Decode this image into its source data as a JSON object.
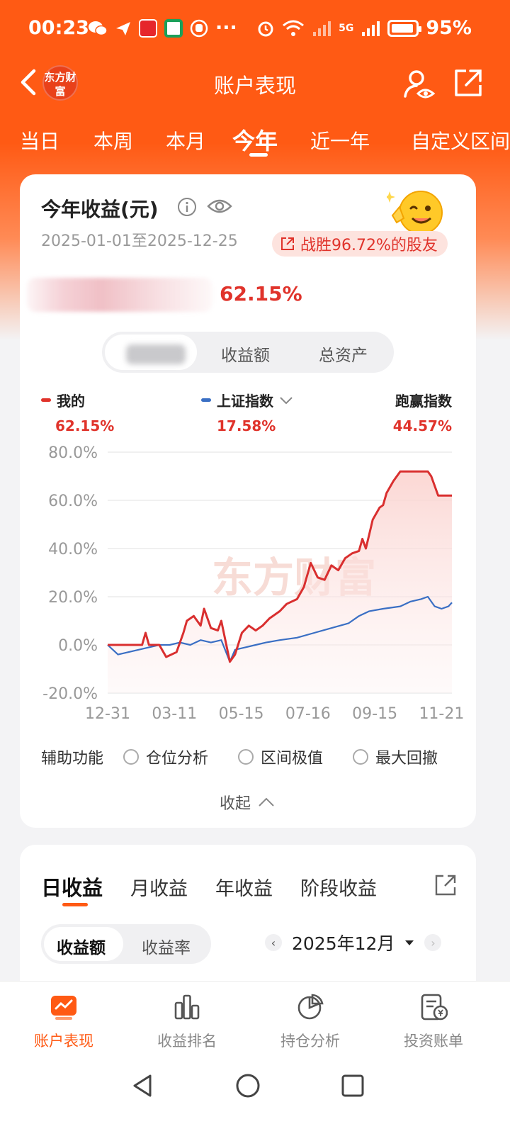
{
  "status_bar": {
    "time": "00:23",
    "more": "···",
    "signal_label": "5G",
    "battery": "95%"
  },
  "nav": {
    "logo_text": "东方财富",
    "title": "账户表现"
  },
  "period_tabs": [
    {
      "label": "当日"
    },
    {
      "label": "本周"
    },
    {
      "label": "本月"
    },
    {
      "label": "今年",
      "active": true
    },
    {
      "label": "近一年"
    },
    {
      "label": "自定义区间"
    }
  ],
  "summary": {
    "title": "今年收益(元)",
    "date_range": "2025-01-01至2025-12-25",
    "beat_text": "战胜96.72%的股友",
    "return_pct": "62.15%"
  },
  "segment": {
    "items": [
      "收益额",
      "总资产"
    ]
  },
  "legend": [
    {
      "name": "我的",
      "value": "62.15%",
      "color": "#e0332b"
    },
    {
      "name": "上证指数",
      "value": "17.58%",
      "color": "#3a6fc4",
      "dropdown": true
    },
    {
      "name": "跑赢指数",
      "value": "44.57%"
    }
  ],
  "chart_data": {
    "type": "line",
    "watermark": "东方财富",
    "y_ticks": [
      "80.0%",
      "60.0%",
      "40.0%",
      "20.0%",
      "0.0%",
      "-20.0%"
    ],
    "ylim": [
      -20,
      80
    ],
    "x_ticks": [
      "12-31",
      "03-11",
      "05-15",
      "07-16",
      "09-15",
      "11-21"
    ],
    "xlim": [
      0,
      1
    ],
    "series": [
      {
        "name": "我的",
        "color": "#d92f2f",
        "points": [
          [
            0,
            0
          ],
          [
            0.1,
            0
          ],
          [
            0.11,
            5
          ],
          [
            0.12,
            0
          ],
          [
            0.15,
            0
          ],
          [
            0.17,
            -5
          ],
          [
            0.2,
            -3
          ],
          [
            0.22,
            5
          ],
          [
            0.23,
            10
          ],
          [
            0.25,
            12
          ],
          [
            0.27,
            8
          ],
          [
            0.28,
            15
          ],
          [
            0.3,
            7
          ],
          [
            0.32,
            6
          ],
          [
            0.33,
            10
          ],
          [
            0.355,
            -7
          ],
          [
            0.37,
            -4
          ],
          [
            0.39,
            5
          ],
          [
            0.41,
            8
          ],
          [
            0.43,
            6
          ],
          [
            0.45,
            8
          ],
          [
            0.47,
            11
          ],
          [
            0.5,
            14
          ],
          [
            0.52,
            17
          ],
          [
            0.55,
            19
          ],
          [
            0.57,
            24
          ],
          [
            0.59,
            34
          ],
          [
            0.61,
            28
          ],
          [
            0.63,
            27
          ],
          [
            0.65,
            33
          ],
          [
            0.67,
            31
          ],
          [
            0.69,
            36
          ],
          [
            0.71,
            38
          ],
          [
            0.73,
            39
          ],
          [
            0.74,
            44
          ],
          [
            0.75,
            40
          ],
          [
            0.76,
            46
          ],
          [
            0.77,
            52
          ],
          [
            0.79,
            57
          ],
          [
            0.8,
            58
          ],
          [
            0.81,
            63
          ],
          [
            0.83,
            68
          ],
          [
            0.85,
            72
          ],
          [
            0.87,
            72
          ],
          [
            0.92,
            72
          ],
          [
            0.93,
            72
          ],
          [
            0.94,
            70
          ],
          [
            0.96,
            62
          ],
          [
            0.98,
            62
          ],
          [
            1,
            62
          ]
        ]
      },
      {
        "name": "上证指数",
        "color": "#3a6fc4",
        "points": [
          [
            0,
            0
          ],
          [
            0.03,
            -4
          ],
          [
            0.06,
            -3
          ],
          [
            0.09,
            -2
          ],
          [
            0.12,
            -1
          ],
          [
            0.15,
            0
          ],
          [
            0.18,
            0
          ],
          [
            0.21,
            1
          ],
          [
            0.24,
            0
          ],
          [
            0.27,
            2
          ],
          [
            0.3,
            1
          ],
          [
            0.33,
            2
          ],
          [
            0.355,
            -7
          ],
          [
            0.37,
            -2
          ],
          [
            0.4,
            -1
          ],
          [
            0.43,
            0
          ],
          [
            0.46,
            1
          ],
          [
            0.5,
            2
          ],
          [
            0.55,
            3
          ],
          [
            0.6,
            5
          ],
          [
            0.65,
            7
          ],
          [
            0.7,
            9
          ],
          [
            0.73,
            12
          ],
          [
            0.76,
            14
          ],
          [
            0.8,
            15
          ],
          [
            0.85,
            16
          ],
          [
            0.88,
            18
          ],
          [
            0.91,
            19
          ],
          [
            0.93,
            20
          ],
          [
            0.95,
            16
          ],
          [
            0.97,
            15
          ],
          [
            0.99,
            16
          ],
          [
            1,
            17.6
          ]
        ]
      }
    ]
  },
  "aux": {
    "label": "辅助功能",
    "options": [
      "仓位分析",
      "区间极值",
      "最大回撤"
    ],
    "collapse": "收起"
  },
  "earnings": {
    "tabs": [
      {
        "label": "日收益",
        "active": true
      },
      {
        "label": "月收益"
      },
      {
        "label": "年收益"
      },
      {
        "label": "阶段收益"
      }
    ],
    "segment": [
      {
        "label": "收益额",
        "active": true
      },
      {
        "label": "收益率"
      }
    ],
    "month": "2025年12月"
  },
  "bottom_nav": [
    {
      "label": "账户表现",
      "icon": "chart-card-icon",
      "active": true
    },
    {
      "label": "收益排名",
      "icon": "bar-chart-icon"
    },
    {
      "label": "持仓分析",
      "icon": "pie-chart-icon"
    },
    {
      "label": "投资账单",
      "icon": "bill-icon"
    }
  ],
  "colors": {
    "brand": "#ff5a14",
    "up": "#e0332b",
    "index": "#3a6fc4"
  }
}
